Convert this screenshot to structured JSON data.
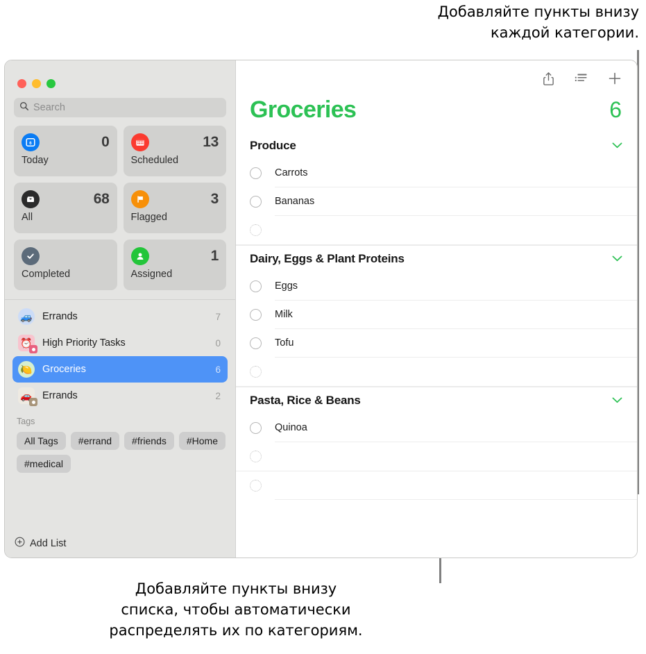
{
  "callouts": {
    "top": "Добавляйте пункты внизу\nкаждой категории.",
    "bottom": "Добавляйте пункты внизу\nсписка, чтобы автоматически\nраспределять их по категориям."
  },
  "colors": {
    "accent_green": "#2cc154",
    "selection_blue": "#4e93f7",
    "sidebar_bg": "#e4e4e2",
    "traffic_close": "#ff6159",
    "traffic_min": "#ffbd2e",
    "traffic_max": "#28c840"
  },
  "window": {
    "traffic_lights": [
      "close",
      "minimize",
      "maximize"
    ]
  },
  "sidebar": {
    "search": {
      "placeholder": "Search",
      "value": ""
    },
    "smart_lists": [
      {
        "label": "Today",
        "count": "0",
        "icon": "calendar-day-icon",
        "color": "#0a7cf4"
      },
      {
        "label": "Scheduled",
        "count": "13",
        "icon": "calendar-icon",
        "color": "#fb3b30"
      },
      {
        "label": "All",
        "count": "68",
        "icon": "inbox-icon",
        "color": "#2b2b2b"
      },
      {
        "label": "Flagged",
        "count": "3",
        "icon": "flag-icon",
        "color": "#f79009"
      },
      {
        "label": "Completed",
        "count": "",
        "icon": "checkmark-icon",
        "color": "#5c6b7a"
      },
      {
        "label": "Assigned",
        "count": "1",
        "icon": "person-icon",
        "color": "#23c53a"
      }
    ],
    "lists": [
      {
        "name": "Errands",
        "count": "7",
        "emoji": "🚙",
        "bg": "#ccdcf7",
        "shape": "circle",
        "selected": false,
        "gear": false
      },
      {
        "name": "High Priority Tasks",
        "count": "0",
        "emoji": "⏰",
        "bg": "#f8c4ce",
        "shape": "square",
        "selected": false,
        "gear": true,
        "gear_color": "#e8607f"
      },
      {
        "name": "Groceries",
        "count": "6",
        "emoji": "🍋",
        "bg": "#d6efcf",
        "shape": "circle",
        "selected": true,
        "gear": false
      },
      {
        "name": "Errands",
        "count": "2",
        "emoji": "🚗",
        "bg": "#eeeae2",
        "shape": "square",
        "selected": false,
        "gear": true,
        "gear_color": "#a8957a"
      }
    ],
    "tags_title": "Tags",
    "tags": [
      "All Tags",
      "#errand",
      "#friends",
      "#Home",
      "#medical"
    ],
    "add_list_label": "Add List"
  },
  "main": {
    "toolbar": [
      {
        "name": "share-icon",
        "label": "Share"
      },
      {
        "name": "list-view-icon",
        "label": "Group View"
      },
      {
        "name": "plus-icon",
        "label": "New Reminder"
      }
    ],
    "title": "Groceries",
    "total": "6",
    "sections": [
      {
        "title": "Produce",
        "items": [
          "Carrots",
          "Bananas"
        ],
        "has_new_row": true
      },
      {
        "title": "Dairy, Eggs & Plant Proteins",
        "items": [
          "Eggs",
          "Milk",
          "Tofu"
        ],
        "has_new_row": true
      },
      {
        "title": "Pasta, Rice & Beans",
        "items": [
          "Quinoa"
        ],
        "has_new_row": true
      }
    ],
    "trailing_new_row": true
  }
}
